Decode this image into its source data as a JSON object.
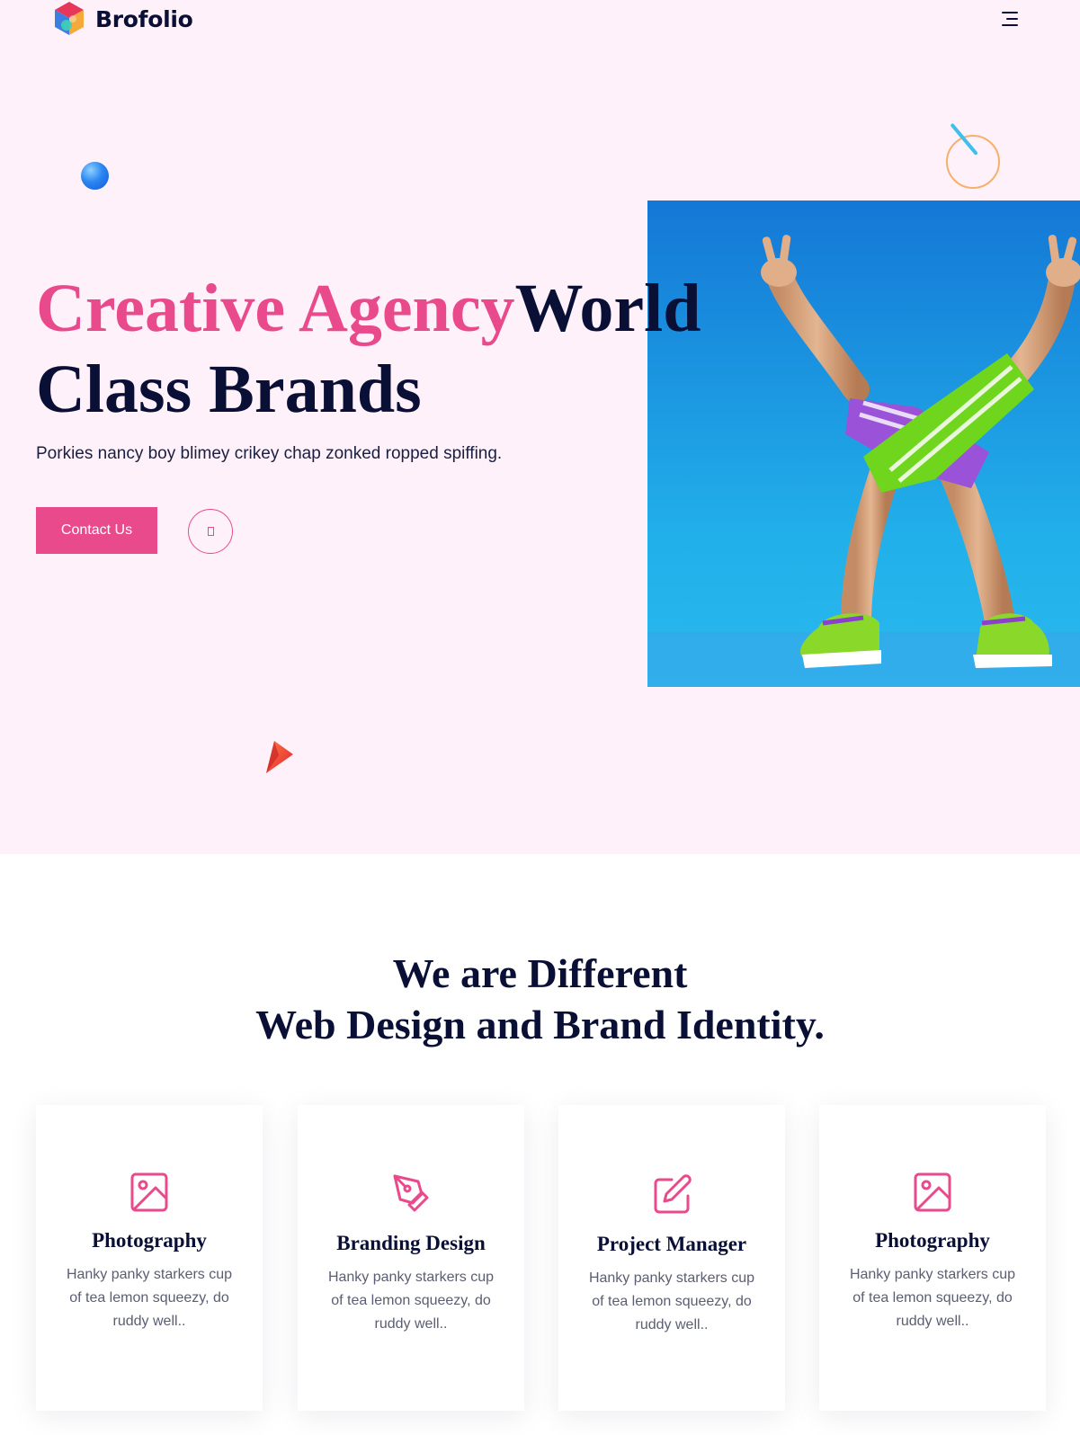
{
  "nav": {
    "brand": "Brofolio",
    "logo_icon": "brofolio-hexagon-logo",
    "menu_icon": "hamburger-menu-icon"
  },
  "hero": {
    "title_accent": "Creative Agency",
    "title_line1_rest": "World",
    "title_line2": "Class Brands",
    "subtitle": "Porkies nancy boy blimey crikey chap zonked ropped spiffing.",
    "cta_label": "Contact Us",
    "play_icon": "play-icon",
    "image_alt": "3D cartoon legs with peace-sign hands, green and purple shorts and sneakers on blue background"
  },
  "services": {
    "title_line1": "We are Different",
    "title_line2": "Web Design and Brand Identity.",
    "cards": [
      {
        "title": "Photography",
        "text": "Hanky panky starkers cup of tea lemon squeezy, do ruddy well..",
        "icon": "image-icon"
      },
      {
        "title": "Branding Design",
        "text": "Hanky panky starkers cup of tea lemon squeezy, do ruddy well..",
        "icon": "pen-tool-icon"
      },
      {
        "title": "Project Manager",
        "text": "Hanky panky starkers cup of tea lemon squeezy, do ruddy well..",
        "icon": "edit-icon"
      },
      {
        "title": "Photography",
        "text": "Hanky panky starkers cup of tea lemon squeezy, do ruddy well..",
        "icon": "image-icon"
      }
    ]
  },
  "colors": {
    "accent": "#e84a8c",
    "heading": "#0a0f36",
    "hero_bg": "#fff1fa",
    "image_bg": "#1e8ee0"
  }
}
